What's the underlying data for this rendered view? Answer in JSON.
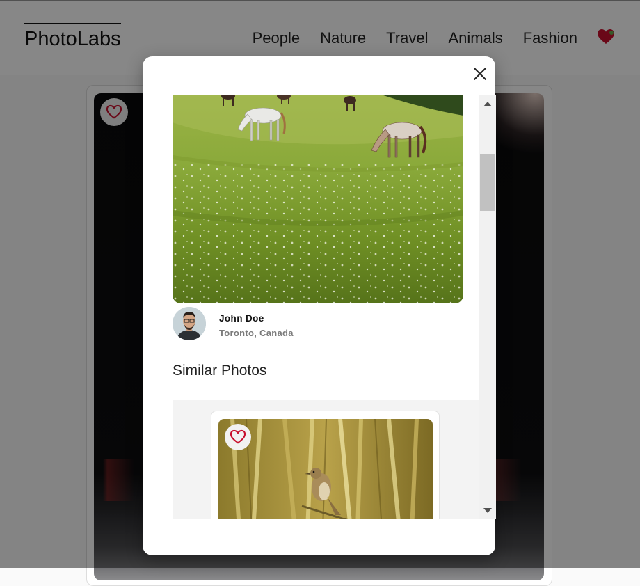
{
  "nav": {
    "logo": "PhotoLabs",
    "topics": [
      "People",
      "Nature",
      "Travel",
      "Animals",
      "Fashion"
    ],
    "favorites_icon": "heart-icon"
  },
  "modal": {
    "close_icon": "close-icon",
    "photo": {
      "subject": "horses grazing on a grassy hillside",
      "user_name": "John Doe",
      "user_location": "Toronto, Canada"
    },
    "similar_title": "Similar Photos",
    "similar_photos": [
      {
        "subject": "small bird perched among reeds",
        "fav_icon": "heart-outline-icon"
      }
    ]
  },
  "colors": {
    "heart_red": "#c8102e",
    "overlay": "rgba(0,0,0,0.47)"
  }
}
